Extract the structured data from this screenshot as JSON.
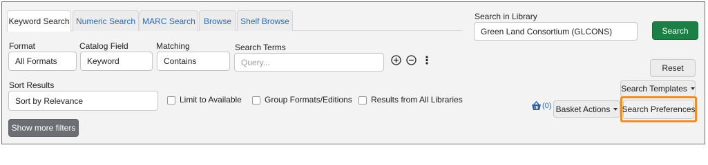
{
  "tabs": [
    {
      "label": "Keyword Search",
      "active": true
    },
    {
      "label": "Numeric Search",
      "active": false
    },
    {
      "label": "MARC Search",
      "active": false
    },
    {
      "label": "Browse",
      "active": false
    },
    {
      "label": "Shelf Browse",
      "active": false
    }
  ],
  "search_row": {
    "format": {
      "label": "Format",
      "value": "All Formats"
    },
    "catalog_field": {
      "label": "Catalog Field",
      "value": "Keyword"
    },
    "matching": {
      "label": "Matching",
      "value": "Contains"
    },
    "search_terms": {
      "label": "Search Terms",
      "placeholder": "Query..."
    }
  },
  "row_controls": {
    "add_icon": "plus-circle-icon",
    "remove_icon": "minus-circle-icon",
    "more_icon": "kebab-menu-icon"
  },
  "sort": {
    "label": "Sort Results",
    "value": "Sort by Relevance"
  },
  "filters": {
    "limit_available": "Limit to Available",
    "group_formats": "Group Formats/Editions",
    "all_libraries": "Results from All Libraries"
  },
  "show_more_filters": "Show more filters",
  "library": {
    "label": "Search in Library",
    "value": "Green Land Consortium (GLCONS)"
  },
  "buttons": {
    "search": "Search",
    "reset": "Reset",
    "search_templates": "Search Templates",
    "basket_actions": "Basket Actions",
    "search_preferences": "Search Preferences"
  },
  "basket": {
    "icon": "basket-icon",
    "count": "(0)"
  },
  "colors": {
    "search_button": "#1c7f45",
    "highlight": "#f28c1e",
    "link": "#2a6ab5"
  }
}
